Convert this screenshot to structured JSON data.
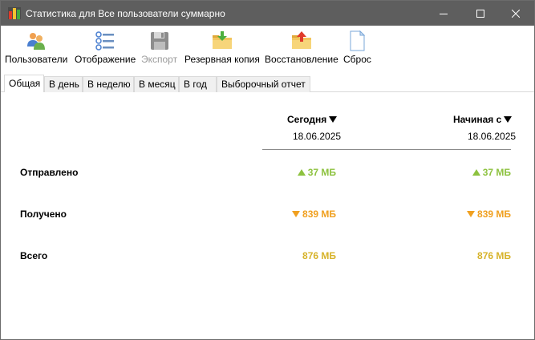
{
  "window": {
    "title": "Статистика для Все пользователи суммарно",
    "icon": "bar-chart-app-icon"
  },
  "toolbar": {
    "items": [
      {
        "label": "Пользователи",
        "icon": "users-icon",
        "enabled": true
      },
      {
        "label": "Отображение",
        "icon": "list-icon",
        "enabled": true
      },
      {
        "label": "Экспорт",
        "icon": "floppy-disk-icon",
        "enabled": false
      },
      {
        "label": "Резервная копия",
        "icon": "folder-download-icon",
        "enabled": true
      },
      {
        "label": "Восстановление",
        "icon": "folder-upload-icon",
        "enabled": true
      },
      {
        "label": "Сброс",
        "icon": "blank-document-icon",
        "enabled": true
      }
    ]
  },
  "tabs": [
    {
      "label": "Общая",
      "active": true
    },
    {
      "label": "В день",
      "active": false
    },
    {
      "label": "В неделю",
      "active": false
    },
    {
      "label": "В месяц",
      "active": false
    },
    {
      "label": "В год",
      "active": false
    },
    {
      "label": "Выборочный отчет",
      "active": false
    }
  ],
  "columns": {
    "today": {
      "header": "Сегодня",
      "date": "18.06.2025"
    },
    "since": {
      "header": "Начиная с",
      "date": "18.06.2025"
    }
  },
  "rows": {
    "sent": {
      "label": "Отправлено",
      "today": "37 МБ",
      "since": "37 МБ"
    },
    "received": {
      "label": "Получено",
      "today": "839 МБ",
      "since": "839 МБ"
    },
    "total": {
      "label": "Всего",
      "today": "876 МБ",
      "since": "876 МБ"
    }
  },
  "colors": {
    "titlebar": "#5e5e5e",
    "sent": "#8dc23f",
    "received": "#f0a020",
    "total": "#d7b32a"
  }
}
